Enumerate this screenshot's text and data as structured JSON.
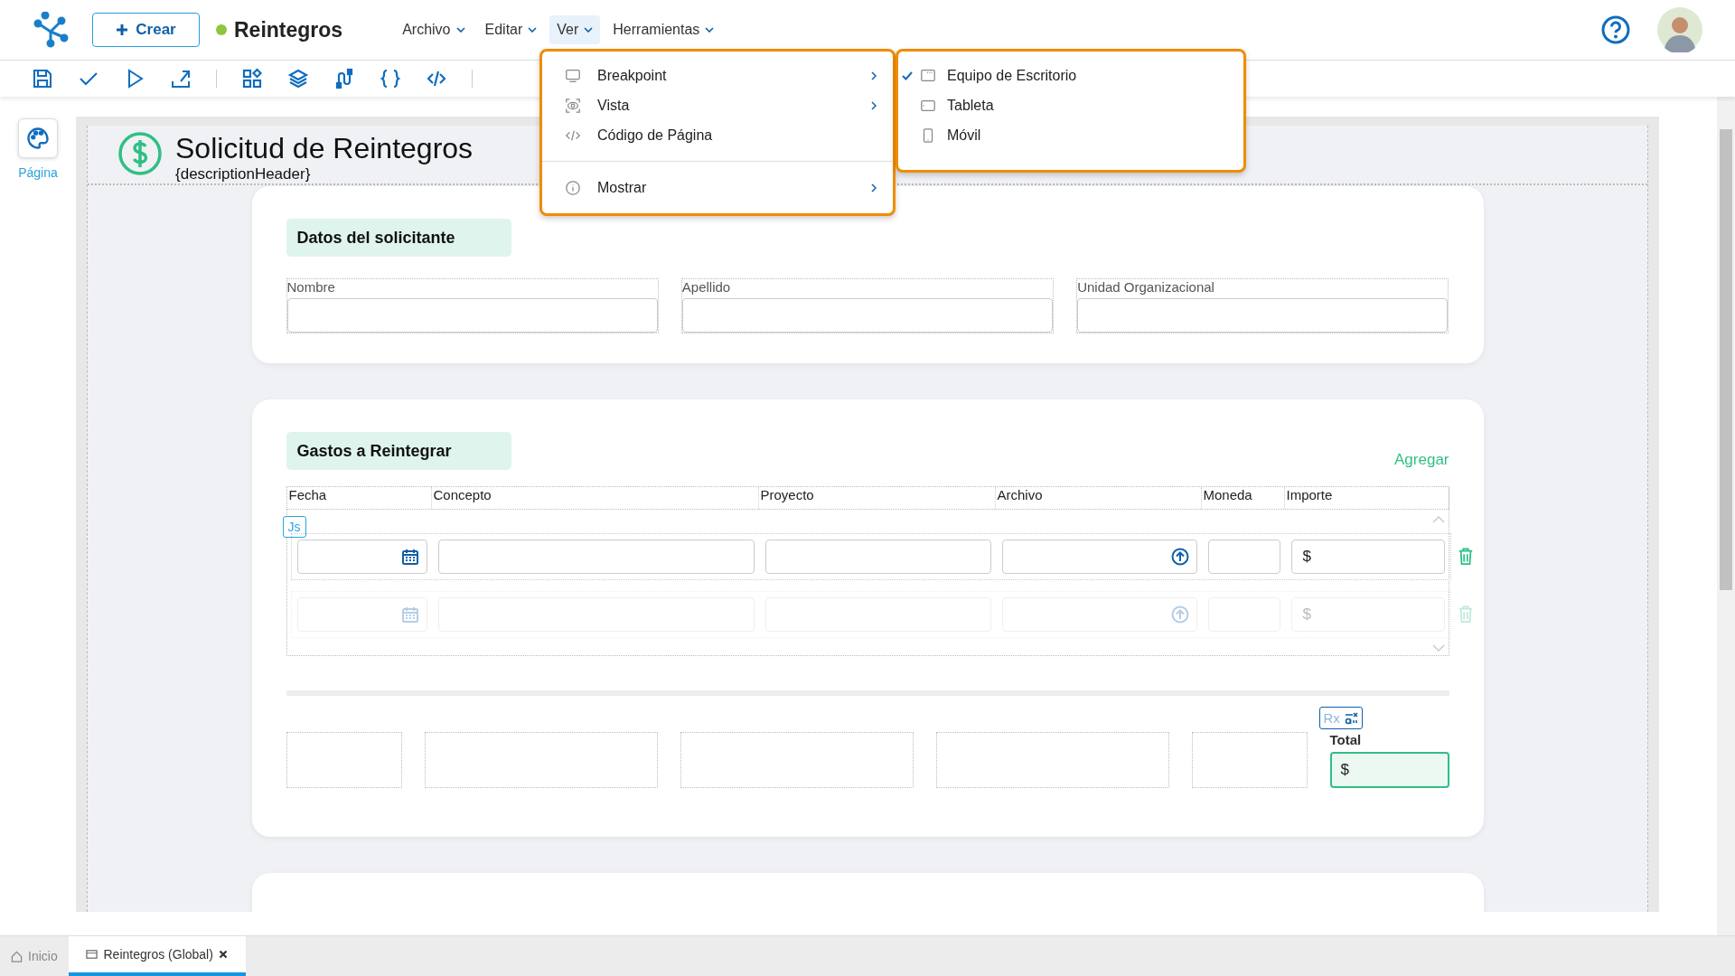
{
  "app_bar": {
    "create_button": "Crear",
    "project": {
      "name": "Reintegros"
    },
    "menus": [
      {
        "label": "Archivo",
        "selected": false
      },
      {
        "label": "Editar",
        "selected": false
      },
      {
        "label": "Ver",
        "selected": true
      },
      {
        "label": "Herramientas",
        "selected": false
      }
    ]
  },
  "open_menu": {
    "items": [
      {
        "label": "Breakpoint",
        "has_submenu": true
      },
      {
        "label": "Vista",
        "has_submenu": true
      },
      {
        "label": "Código de Página",
        "has_submenu": false
      },
      {
        "label": "Mostrar",
        "has_submenu": true
      }
    ],
    "submenu": [
      {
        "label": "Equipo de Escritorio",
        "checked": true
      },
      {
        "label": "Tableta",
        "checked": false
      },
      {
        "label": "Móvil",
        "checked": false
      }
    ]
  },
  "sidebar": {
    "label": "Página"
  },
  "page": {
    "title": "Solicitud de Reintegros",
    "subtitle": "{descriptionHeader}"
  },
  "applicant_section": {
    "title": "Datos del solicitante",
    "fields": [
      {
        "label": "Nombre"
      },
      {
        "label": "Apellido"
      },
      {
        "label": "Unidad Organizacional"
      }
    ]
  },
  "expenses_section": {
    "title": "Gastos a Reintegrar",
    "add_link": "Agregar",
    "script_badge": "Js",
    "columns": [
      "Fecha",
      "Concepto",
      "Proyecto",
      "Archivo",
      "Moneda",
      "Importe"
    ],
    "rows": [
      {
        "disabled": false,
        "amount": "$"
      },
      {
        "disabled": true,
        "amount": "$"
      }
    ],
    "total": {
      "badge": "Rx",
      "label": "Total",
      "value": "$"
    }
  },
  "bottom_tabs": [
    {
      "label": "Inicio",
      "selected": false
    },
    {
      "label": "Reintegros (Global)",
      "selected": true
    }
  ]
}
